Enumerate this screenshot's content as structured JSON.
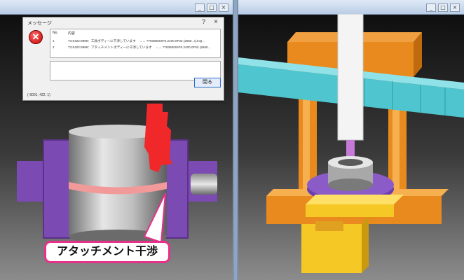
{
  "window_buttons": [
    "_",
    "□",
    "×"
  ],
  "dialog": {
    "title": "メッセージ",
    "help_label": "?",
    "close_label": "×",
    "columns": [
      "No.",
      "内容"
    ],
    "rows": [
      {
        "no": "1",
        "text": "T3:0422:9999：工具ボディーに干渉しています　→→ ??9390004F0.2400.0F03 (2560...(UnQ..."
      },
      {
        "no": "2",
        "text": "T3:0422:9999：アタッチメントボディーに干渉しています　→→ ??9390004F0.2400.0F03 (2560..."
      }
    ],
    "close_button_label": "閉る",
    "status_text": "(-9001, 422, 1)"
  },
  "callout": {
    "text": "アタッチメント干渉"
  },
  "colors": {
    "callout_border": "#e7308a",
    "interference": "#f0282a",
    "clamp": "#7b4bb3"
  }
}
